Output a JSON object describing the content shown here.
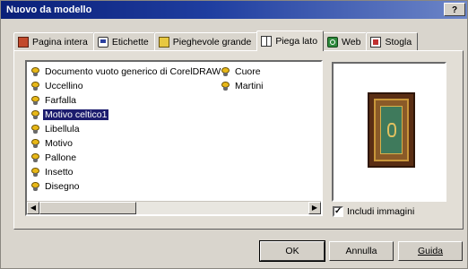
{
  "window": {
    "title": "Nuovo da modello",
    "help_label": "?"
  },
  "tabs": [
    {
      "label": "Pagina intera",
      "icon": "full-page-icon",
      "active": false
    },
    {
      "label": "Etichette",
      "icon": "label-icon",
      "active": false
    },
    {
      "label": "Pieghevole grande",
      "icon": "folder-icon",
      "active": false
    },
    {
      "label": "Piega lato",
      "icon": "side-fold-icon",
      "active": true
    },
    {
      "label": "Web",
      "icon": "web-icon",
      "active": false
    },
    {
      "label": "Stogla",
      "icon": "style-icon",
      "active": false
    }
  ],
  "templates": {
    "column1": [
      "Documento vuoto generico di CorelDRAW",
      "Uccellino",
      "Farfalla",
      "Motivo celtico1",
      "Libellula",
      "Motivo",
      "Pallone",
      "Insetto",
      "Disegno"
    ],
    "column2": [
      "Cuore",
      "Martini"
    ],
    "selected": "Motivo celtico1"
  },
  "preview": {
    "include_images_label": "Includi immagini",
    "include_images_checked": true
  },
  "buttons": {
    "ok": "OK",
    "cancel": "Annulla",
    "help": "Guida"
  },
  "colors": {
    "title_start": "#0a1f78",
    "title_end": "#6d86c8",
    "selection": "#1c1c6e"
  }
}
